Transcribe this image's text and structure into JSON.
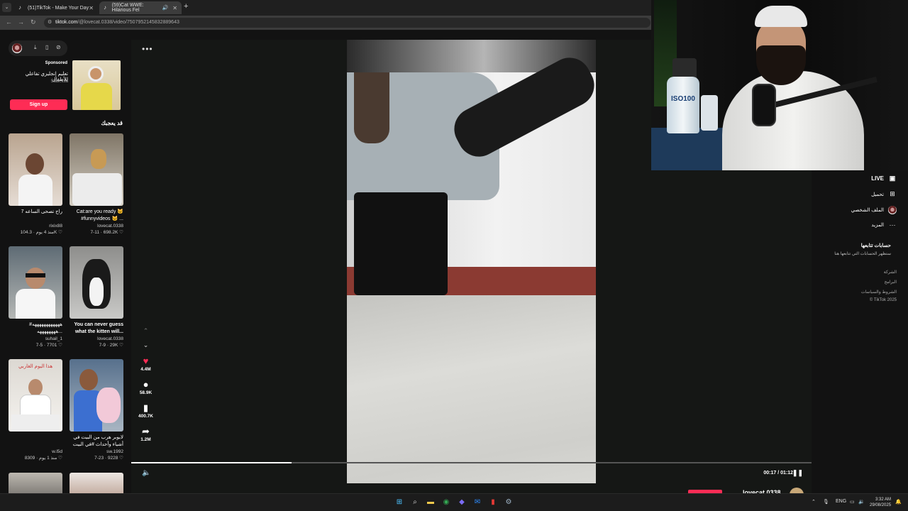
{
  "browser": {
    "tabs": [
      {
        "title": "(51)TikTok - Make Your Day"
      },
      {
        "title": "(59)Cat WWE: Hilarious Fel"
      }
    ],
    "url_domain": "tiktok.com",
    "url_path": "/@lovecat.0338/video/7507952145832889643"
  },
  "sidebar": {
    "sponsored_label": "Sponsored",
    "ad_title": "تعليم إنجليزي تفاعلي للأطفال",
    "ad_handle": "Stalk.ksa",
    "signup_label": "Sign up",
    "section_title": "قد يعجبك",
    "cards": [
      {
        "caption": "راح تصحى الساعه 7",
        "author": "rixix88",
        "meta": "منذ 4 يوم · 104.3K ♡"
      },
      {
        "caption": "Cat:are you ready 🐱 #funnyvideos 🐱 ...",
        "author": "lovecat.0338",
        "meta": "7-11 · 698.2K ♡"
      },
      {
        "caption": "#ههههههههههههه ...ههههههههه",
        "author": "suhail_1",
        "meta": "7-5 · 7701 ♡"
      },
      {
        "caption": "You can never guess what the kitten will...",
        "author": "lovecat.0338",
        "meta": "7-9 · 29K ♡"
      },
      {
        "caption": "",
        "author": "w.l5d",
        "meta": "منذ 1 يوم · 8309 ♡"
      },
      {
        "caption": "لايوبر هرب من البيت في أشياء وأحداث #في البيت حالي الـ...",
        "author": "sw.1992",
        "meta": "7-23 · 9228 ♡"
      }
    ],
    "card5_banner": "هذا اليوم الغاربي"
  },
  "player": {
    "more_label": "•••",
    "likes": "4.4M",
    "comments": "58.9K",
    "saves": "400.7K",
    "shares": "1.2M",
    "time": "00:17 / 01:12",
    "progress": 0.236,
    "author": "lovecat.0338"
  },
  "right_nav": {
    "live": "LIVE",
    "upload": "تحميل",
    "profile": "الملف الشخصي",
    "more": "المزيد",
    "following_title": "حسابات تتابعها",
    "following_sub": "ستظهر الحسابات التي تتابعها هنا",
    "links": [
      "الشركة",
      "البرامج",
      "الشروط والسياسات",
      "© TikTok 2025"
    ]
  },
  "webcam": {
    "bottle_label": "ISO100"
  },
  "taskbar": {
    "lang": "ENG",
    "time": "3:32 AM",
    "date": "29/08/2025"
  },
  "colors": {
    "accent": "#fe2c55",
    "background": "#121212"
  }
}
